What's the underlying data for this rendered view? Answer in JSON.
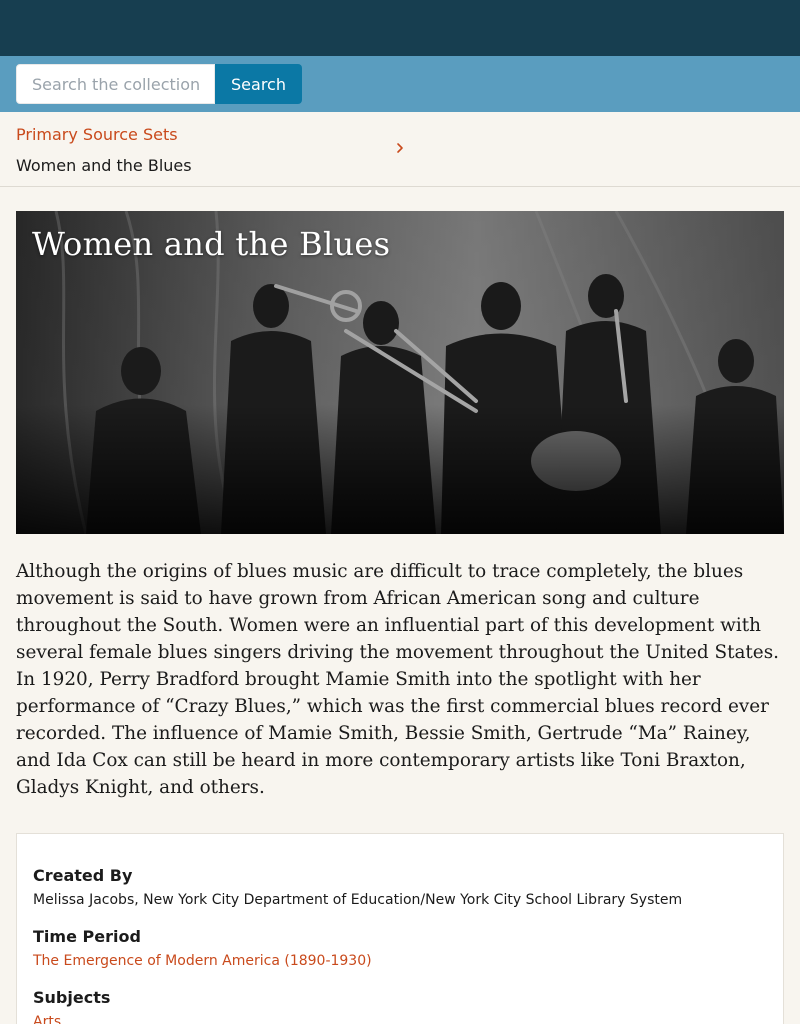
{
  "search": {
    "placeholder": "Search the collection",
    "button_label": "Search"
  },
  "breadcrumb": {
    "parent_label": "Primary Source Sets",
    "current_label": "Women and the Blues"
  },
  "hero": {
    "title": "Women and the Blues"
  },
  "description": "Although the origins of blues music are difficult to trace completely, the blues movement is said to have grown from African American song and culture throughout the South. Women were an influential part of this development with several female blues singers driving the movement throughout the United States. In 1920, Perry Bradford brought Mamie Smith into the spotlight with her performance of “Crazy Blues,” which was the first commercial blues record ever recorded. The influence of Mamie Smith, Bessie Smith, Gertrude “Ma” Rainey, and Ida Cox can still be heard in more contemporary artists like Toni Braxton, Gladys Knight, and others.",
  "details": {
    "created_by_label": "Created By",
    "created_by_value": "Melissa Jacobs, New York City Department of Education/New York City School Library System",
    "time_period_label": "Time Period",
    "time_period_value": "The Emergence of Modern America (1890-1930)",
    "subjects_label": "Subjects",
    "subjects_value": "Arts"
  },
  "colors": {
    "topbar": "#173e50",
    "searchbar": "#5a9dbf",
    "search_button": "#0b78a5",
    "link": "#c94a1c",
    "page_background": "#f8f5ef"
  }
}
